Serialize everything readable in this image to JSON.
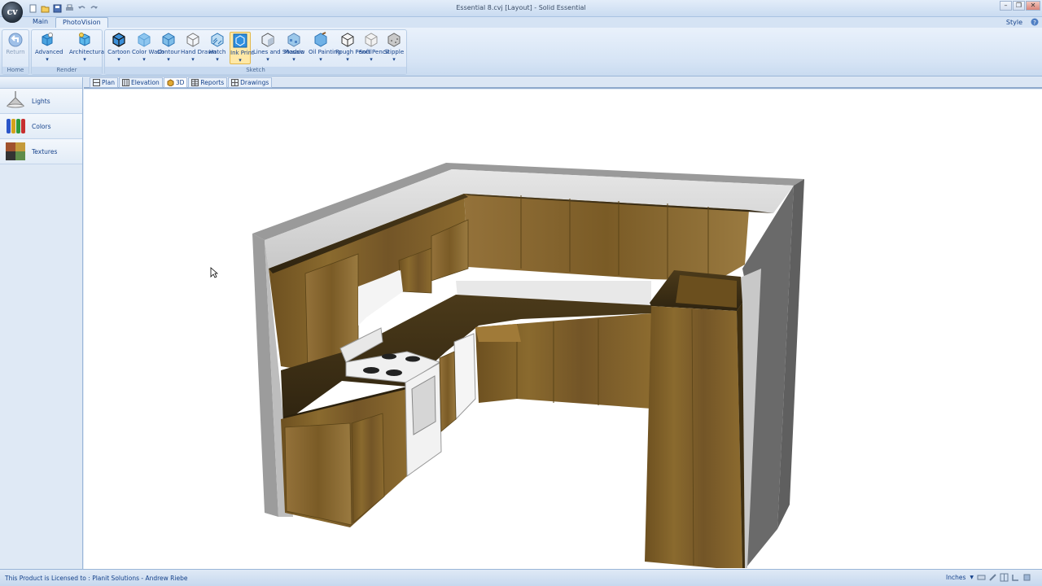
{
  "app": {
    "window_title": "Essential 8.cvj [Layout] - Solid Essential",
    "orb_label": "cv"
  },
  "quick_access": [
    "new-icon",
    "open-icon",
    "save-icon",
    "print-icon",
    "undo-icon",
    "redo-icon"
  ],
  "ribbon": {
    "tabs": [
      {
        "label": "Main",
        "active": false
      },
      {
        "label": "PhotoVision",
        "active": true
      }
    ],
    "style_label": "Style",
    "groups": [
      {
        "label": "Home",
        "buttons": [
          {
            "label": "Return",
            "icon": "return-icon",
            "disabled": true
          }
        ]
      },
      {
        "label": "Render",
        "buttons": [
          {
            "label": "Advanced",
            "icon": "advanced-render-icon"
          },
          {
            "label": "Architectural",
            "icon": "architectural-render-icon"
          }
        ]
      },
      {
        "label": "Sketch",
        "buttons": [
          {
            "label": "Cartoon",
            "icon": "cartoon-icon"
          },
          {
            "label": "Color Wash",
            "icon": "color-wash-icon"
          },
          {
            "label": "Contour",
            "icon": "contour-icon"
          },
          {
            "label": "Hand Drawn",
            "icon": "hand-drawn-icon"
          },
          {
            "label": "Hatch",
            "icon": "hatch-icon"
          },
          {
            "label": "Ink Print",
            "icon": "ink-print-icon",
            "selected": true
          },
          {
            "label": "Lines and Shadow",
            "icon": "lines-and-shadow-icon"
          },
          {
            "label": "Mosaic",
            "icon": "mosaic-icon"
          },
          {
            "label": "Oil Painting",
            "icon": "oil-painting-icon"
          },
          {
            "label": "Rough Pencil",
            "icon": "rough-pencil-icon"
          },
          {
            "label": "Soft Pencil",
            "icon": "soft-pencil-icon"
          },
          {
            "label": "Stipple",
            "icon": "stipple-icon"
          }
        ]
      }
    ]
  },
  "left_panel": {
    "items": [
      {
        "label": "Lights",
        "icon": "lamp-icon"
      },
      {
        "label": "Colors",
        "icon": "paint-tubes-icon"
      },
      {
        "label": "Textures",
        "icon": "texture-swatch-icon"
      }
    ]
  },
  "view_tabs": [
    {
      "label": "Plan",
      "icon": "plan-icon"
    },
    {
      "label": "Elevation",
      "icon": "elevation-icon"
    },
    {
      "label": "3D",
      "icon": "3d-icon",
      "active": true
    },
    {
      "label": "Reports",
      "icon": "reports-icon"
    },
    {
      "label": "Drawings",
      "icon": "drawings-icon"
    }
  ],
  "statusbar": {
    "license_text": "This Product is Licensed to : Planit Solutions - Andrew Riebe",
    "units": "Inches"
  },
  "colors": {
    "wood": "#7a5c24",
    "wood_dark": "#4f3a14",
    "countertop": "#3d2e14",
    "wall_light": "#d9d9d9",
    "wall_dark": "#6f6f6f",
    "ribbon_bg": "#dbe7f6",
    "accent": "#15428b"
  }
}
